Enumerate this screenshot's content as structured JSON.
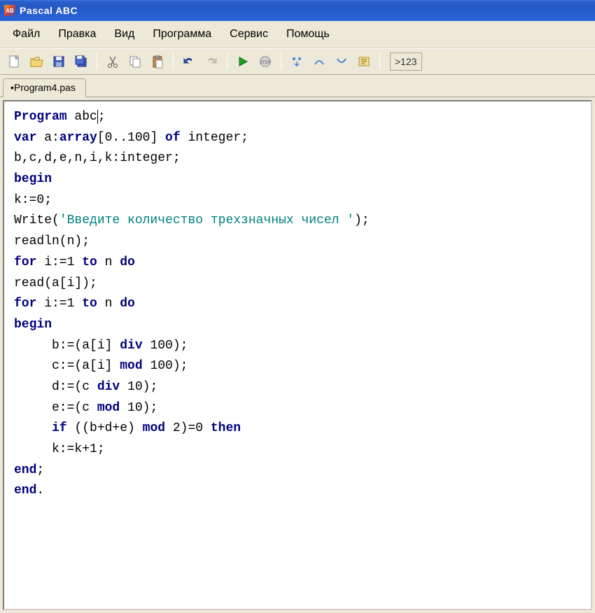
{
  "window": {
    "title": "Pascal ABC"
  },
  "menu": {
    "file": "Файл",
    "edit": "Правка",
    "view": "Вид",
    "program": "Программа",
    "service": "Сервис",
    "help": "Помощь"
  },
  "toolbar": {
    "end_label": ">123"
  },
  "tabs": {
    "active": "•Program4.pas"
  },
  "code": {
    "kw_program": "Program",
    "t_abc": " abc",
    "t_semi": ";",
    "kw_var": "var",
    "t_arr1": " a:",
    "kw_array": "array",
    "t_arr2": "[0..100] ",
    "kw_of": "of",
    "t_arr3": " integer;",
    "t_line3": "b,c,d,e,n,i,k:integer;",
    "kw_begin1": "begin",
    "t_k0": "k:=0;",
    "t_write1": "Write(",
    "str1": "'Введите количество трехзначных чисел '",
    "t_write2": ");",
    "t_readln": "readln(n);",
    "kw_for1": "for",
    "t_for1a": " i:=1 ",
    "kw_to1": "to",
    "t_for1b": " n ",
    "kw_do1": "do",
    "t_read": "read(a[i]);",
    "kw_for2": "for",
    "t_for2a": " i:=1 ",
    "kw_to2": "to",
    "t_for2b": " n ",
    "kw_do2": "do",
    "kw_begin2": "begin",
    "t_b": "     b:=(a[i] ",
    "kw_div1": "div",
    "t_b2": " 100);",
    "t_c": "     c:=(a[i] ",
    "kw_mod1": "mod",
    "t_c2": " 100);",
    "t_d": "     d:=(c ",
    "kw_div2": "div",
    "t_d2": " 10);",
    "t_e": "     e:=(c ",
    "kw_mod2": "mod",
    "t_e2": " 10);",
    "t_if_pad": "     ",
    "kw_if": "if",
    "t_if1": " ((b+d+e) ",
    "kw_mod3": "mod",
    "t_if2": " 2)=0 ",
    "kw_then": "then",
    "t_k1": "     k:=k+1;",
    "kw_end1": "end",
    "t_endsemi": ";",
    "kw_end2": "end",
    "t_enddot": "."
  }
}
